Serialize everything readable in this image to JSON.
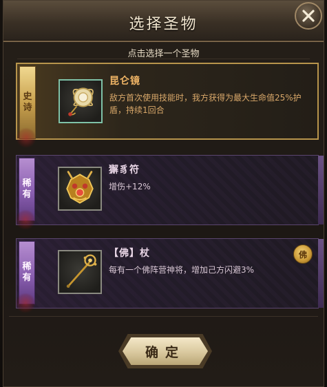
{
  "dialog": {
    "title": "选择圣物",
    "subtitle": "点击选择一个圣物",
    "confirm_label": "确定"
  },
  "items": [
    {
      "rarity": "史诗",
      "rarity_chars": [
        "史",
        "诗"
      ],
      "name": "昆仑镜",
      "description": "敌方首次使用技能时，我方获得为最大生命值25%护盾，持续1回合",
      "icon": "kunlun-mirror-icon"
    },
    {
      "rarity": "稀有",
      "rarity_chars": [
        "稀",
        "有"
      ],
      "name": "獬豸符",
      "description": "增伤+12%",
      "icon": "xiezhi-talisman-icon"
    },
    {
      "rarity": "稀有",
      "rarity_chars": [
        "稀",
        "有"
      ],
      "name": "【佛】杖",
      "description": "每有一个佛阵营神将，增加己方闪避3%",
      "icon": "buddha-staff-icon",
      "faction_badge": "佛"
    }
  ],
  "colors": {
    "epic_border": "#b8954c",
    "rare_border": "#5b4670",
    "epic_name": "#f0b566",
    "title_text": "#f2e6cf"
  }
}
